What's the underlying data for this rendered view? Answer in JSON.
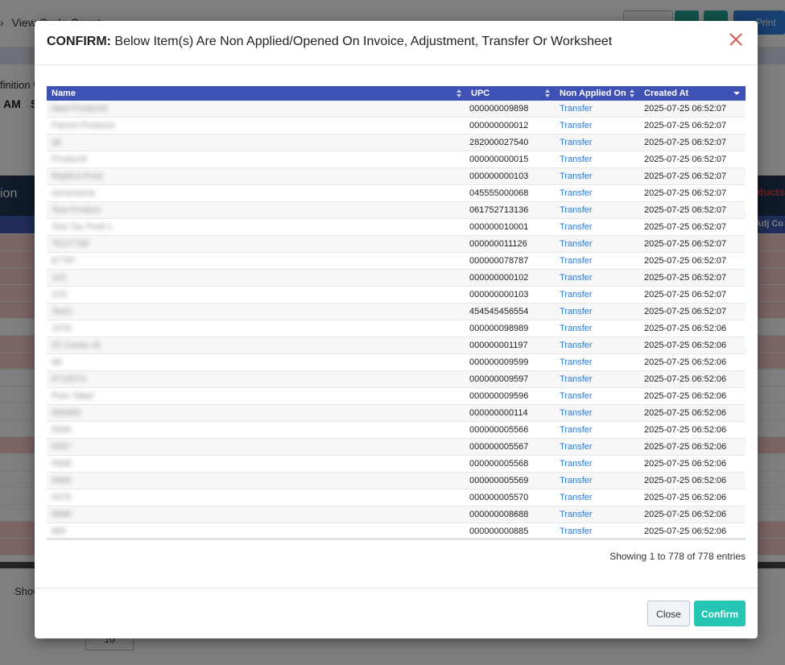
{
  "background": {
    "breadcrumb": "View Cycle Count",
    "print_label": "Print",
    "label_definition": "finition U",
    "label_am": "AM",
    "label_s": "S",
    "band_text": "ion",
    "band_right": "oducts",
    "subhead_right": "Adj Co",
    "show_label": "Show",
    "pager_label": "10"
  },
  "modal": {
    "title_lead": "CONFIRM:",
    "title_rest": " Below Item(s) Are Non Applied/Opened On Invoice, Adjustment, Transfer Or Worksheet",
    "columns": [
      "Name",
      "UPC",
      "Non Applied On",
      "Created At"
    ],
    "rows": [
      {
        "name": "New Product3",
        "upc": "000000009898",
        "on": "Transfer",
        "created": "2025-07-25 06:52:07"
      },
      {
        "name": "Parent Products",
        "upc": "000000000012",
        "on": "Transfer",
        "created": "2025-07-25 06:52:07"
      },
      {
        "name": "ab",
        "upc": "282000027540",
        "on": "Transfer",
        "created": "2025-07-25 06:52:07"
      },
      {
        "name": "Product3",
        "upc": "000000000015",
        "on": "Transfer",
        "created": "2025-07-25 06:52:07"
      },
      {
        "name": "Replica Prod",
        "upc": "000000000103",
        "on": "Transfer",
        "created": "2025-07-25 06:52:07"
      },
      {
        "name": "somename",
        "upc": "045555000068",
        "on": "Transfer",
        "created": "2025-07-25 06:52:07"
      },
      {
        "name": "Test Product",
        "upc": "061752713136",
        "on": "Transfer",
        "created": "2025-07-25 06:52:07"
      },
      {
        "name": "Test Tax Prod 1",
        "upc": "000000010001",
        "on": "Transfer",
        "created": "2025-07-25 06:52:07"
      },
      {
        "name": "TEST789",
        "upc": "000000011126",
        "on": "Transfer",
        "created": "2025-07-25 06:52:07"
      },
      {
        "name": "tt7787",
        "upc": "000000078787",
        "on": "Transfer",
        "created": "2025-07-25 06:52:07"
      },
      {
        "name": "102",
        "upc": "000000000102",
        "on": "Transfer",
        "created": "2025-07-25 06:52:07"
      },
      {
        "name": "103",
        "upc": "000000000103",
        "on": "Transfer",
        "created": "2025-07-25 06:52:07"
      },
      {
        "name": "Test1",
        "upc": "454545456554",
        "on": "Transfer",
        "created": "2025-07-25 06:52:07"
      },
      {
        "name": "1079",
        "upc": "000000098989",
        "on": "Transfer",
        "created": "2025-07-25 06:52:06"
      },
      {
        "name": "25 Cases 1k",
        "upc": "000000001197",
        "on": "Transfer",
        "created": "2025-07-25 06:52:06"
      },
      {
        "name": "dd",
        "upc": "000000009599",
        "on": "Transfer",
        "created": "2025-07-25 06:52:06"
      },
      {
        "name": "8716574",
        "upc": "000000009597",
        "on": "Transfer",
        "created": "2025-07-25 06:52:06"
      },
      {
        "name": "Prev Tabel",
        "upc": "000000009596",
        "on": "Transfer",
        "created": "2025-07-25 06:52:06"
      },
      {
        "name": "d00d00",
        "upc": "000000000114",
        "on": "Transfer",
        "created": "2025-07-25 06:52:06"
      },
      {
        "name": "5566",
        "upc": "000000005566",
        "on": "Transfer",
        "created": "2025-07-25 06:52:06"
      },
      {
        "name": "5567",
        "upc": "000000005567",
        "on": "Transfer",
        "created": "2025-07-25 06:52:06"
      },
      {
        "name": "5568",
        "upc": "000000005568",
        "on": "Transfer",
        "created": "2025-07-25 06:52:06"
      },
      {
        "name": "5569",
        "upc": "000000005569",
        "on": "Transfer",
        "created": "2025-07-25 06:52:06"
      },
      {
        "name": "5570",
        "upc": "000000005570",
        "on": "Transfer",
        "created": "2025-07-25 06:52:06"
      },
      {
        "name": "8688",
        "upc": "000000008688",
        "on": "Transfer",
        "created": "2025-07-25 06:52:06"
      },
      {
        "name": "885",
        "upc": "000000000885",
        "on": "Transfer",
        "created": "2025-07-25 06:52:06"
      }
    ],
    "info": "Showing 1 to 778 of 778 entries",
    "close_label": "Close",
    "confirm_label": "Confirm"
  },
  "colors": {
    "header_blue": "#3f51b5",
    "confirm_teal": "#26c4b4",
    "close_x_red": "#d9534f",
    "link_blue": "#2a7ad6"
  }
}
